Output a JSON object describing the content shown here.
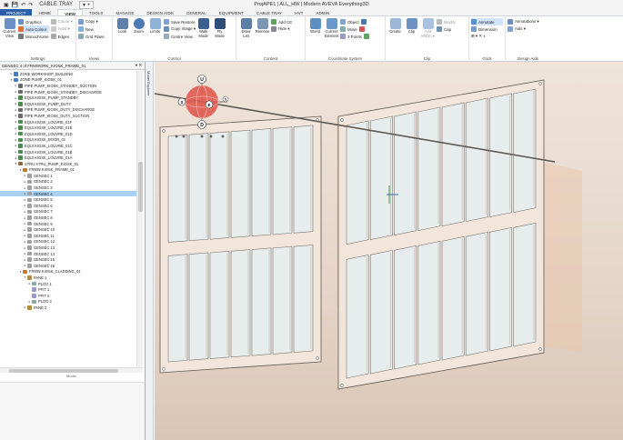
{
  "titlebar": {
    "title": "ProjAPE1 | ALL_HW | Modern AVEVA Everything3D",
    "quick_label": "CABLE TRAY",
    "dropdown": "▾ +"
  },
  "tabs": [
    "PROJECT",
    "HOME",
    "VIEW",
    "TOOLS",
    "MANAGE",
    "DESIGN AIDS",
    "GENERAL",
    "EQUIPMENT",
    "CABLE TRAY",
    "HVT",
    "ADMIN"
  ],
  "ribbon": {
    "settings": {
      "label": "Settings",
      "current_view": "Current View",
      "graphics": "Graphics",
      "auto_colour": "Auto Colour",
      "monochrome": "Monochrome",
      "colour": "Colour ▾",
      "solid": "Solid ▾",
      "edges": "Edges"
    },
    "views": {
      "label": "Views",
      "copy": "Copy ▾",
      "new": "New",
      "grid_plane": "Grid Plane"
    },
    "control": {
      "label": "Control",
      "look": "Look",
      "zoom": "Zoom",
      "limits": "Limits",
      "save_restore": "Save Restore",
      "copy_image": "Copy Image ▾",
      "centre_view": "Centre View",
      "walk_mode": "Walk Mode",
      "fly_mode": "Fly Mode"
    },
    "content": {
      "label": "Content",
      "draw_list": "Draw List",
      "remove": "Remove",
      "add_ce": "Add CE",
      "hide": "Hide ▾"
    },
    "coords": {
      "label": "Coordinate System",
      "world": "World",
      "current_element": "Current Element",
      "object": "Object",
      "move": "Move",
      "three_points": "3 Points"
    },
    "clip": {
      "label": "Clip",
      "create": "Create",
      "clip": "Clip",
      "add_within": "Add Within ▾",
      "modify": "Modify",
      "cap": "Cap"
    },
    "grids": {
      "label": "Grids",
      "annotate": "Annotate",
      "dimension": "Dimension",
      "icons": "⊞ ▾ ✕ ◐"
    },
    "design_aids": {
      "label": "Design Aids",
      "annotations": "Annotations ▾",
      "aids": "Aids ▾"
    }
  },
  "panel": {
    "header": "GENSEC 4 of FRMWORK_KIOSK_FRAME_01",
    "tab_vertical": "Model Explorer",
    "footer": "Model",
    "tree": [
      {
        "label": "ZONE WORKSHOP_BUILDING",
        "indent": 2,
        "tog": "▸"
      },
      {
        "label": "ZONE PUMP_KIOSK_01",
        "indent": 2,
        "tog": "▾"
      },
      {
        "label": "PIPE PUMP_KIOSK_STANDBY_SUCTION",
        "indent": 3,
        "tog": "▸"
      },
      {
        "label": "PIPE PUMP_KIOSK_STANDBY_DISCHARGE",
        "indent": 3,
        "tog": "▸"
      },
      {
        "label": "EQUI KIOSK_PUMP_STANDBY",
        "indent": 3,
        "tog": "▸"
      },
      {
        "label": "EQUI KIOSK_PUMP_DUTY",
        "indent": 3,
        "tog": "▸"
      },
      {
        "label": "PIPE PUMP_KIOSK_DUTY_DISCHARGE",
        "indent": 3,
        "tog": "▸"
      },
      {
        "label": "PIPE PUMP_KIOSK_DUTY_SUCTION",
        "indent": 3,
        "tog": "▸"
      },
      {
        "label": "EQUI KIOSK_LOUVRE_01F",
        "indent": 3,
        "tog": "▸"
      },
      {
        "label": "EQUI KIOSK_LOUVRE_01E",
        "indent": 3,
        "tog": "▸"
      },
      {
        "label": "EQUI KIOSK_LOUVRE_01D",
        "indent": 3,
        "tog": "▸"
      },
      {
        "label": "EQUI KIOSK_DOOR_01",
        "indent": 3,
        "tog": "▸"
      },
      {
        "label": "EQUI KIOSK_LOUVRE_01C",
        "indent": 3,
        "tog": "▸"
      },
      {
        "label": "EQUI KIOSK_LOUVRE_01B",
        "indent": 3,
        "tog": "▸"
      },
      {
        "label": "EQUI KIOSK_LOUVRE_01A",
        "indent": 3,
        "tog": "▸"
      },
      {
        "label": "STRU STRU_PUMP_KIOSK_01",
        "indent": 3,
        "tog": "▾"
      },
      {
        "label": "FRMW KIOSK_FRAME_01",
        "indent": 4,
        "tog": "▾"
      },
      {
        "label": "GENSEC 1",
        "indent": 5,
        "tog": "▸"
      },
      {
        "label": "GENSEC 2",
        "indent": 5,
        "tog": "▸"
      },
      {
        "label": "GENSEC 3",
        "indent": 5,
        "tog": "▸"
      },
      {
        "label": "GENSEC 4",
        "indent": 5,
        "tog": "▸",
        "selected": true
      },
      {
        "label": "GENSEC 5",
        "indent": 5,
        "tog": "▸"
      },
      {
        "label": "GENSEC 6",
        "indent": 5,
        "tog": "▸"
      },
      {
        "label": "GENSEC 7",
        "indent": 5,
        "tog": "▸"
      },
      {
        "label": "GENSEC 8",
        "indent": 5,
        "tog": "▸"
      },
      {
        "label": "GENSEC 9",
        "indent": 5,
        "tog": "▸"
      },
      {
        "label": "GENSEC 10",
        "indent": 5,
        "tog": "▸"
      },
      {
        "label": "GENSEC 11",
        "indent": 5,
        "tog": "▸"
      },
      {
        "label": "GENSEC 12",
        "indent": 5,
        "tog": "▸"
      },
      {
        "label": "GENSEC 13",
        "indent": 5,
        "tog": "▸"
      },
      {
        "label": "GENSEC 14",
        "indent": 5,
        "tog": "▸"
      },
      {
        "label": "GENSEC 15",
        "indent": 5,
        "tog": "▸"
      },
      {
        "label": "GENSEC 16",
        "indent": 5,
        "tog": "▸"
      },
      {
        "label": "FRMW KIOSK_CLADDING_01",
        "indent": 4,
        "tog": "▾"
      },
      {
        "label": "PANE 1",
        "indent": 5,
        "tog": "▾"
      },
      {
        "label": "PLOO 1",
        "indent": 6,
        "tog": "▸"
      },
      {
        "label": "PFIT 1",
        "indent": 6,
        "tog": ""
      },
      {
        "label": "PFIT 2",
        "indent": 6,
        "tog": ""
      },
      {
        "label": "PLOO 2",
        "indent": 6,
        "tog": "▸"
      },
      {
        "label": "PANE 2",
        "indent": 5,
        "tog": "▸"
      }
    ]
  },
  "gizmo": {
    "up": "U",
    "down": "D",
    "east": "E",
    "south": "S",
    "north": "N"
  },
  "colors": {
    "accent": "#2a5ea8",
    "selection": "#a9d0f5",
    "gizmo": "#d9534f",
    "louvre": "#e7edec",
    "frame": "#5e5953"
  }
}
